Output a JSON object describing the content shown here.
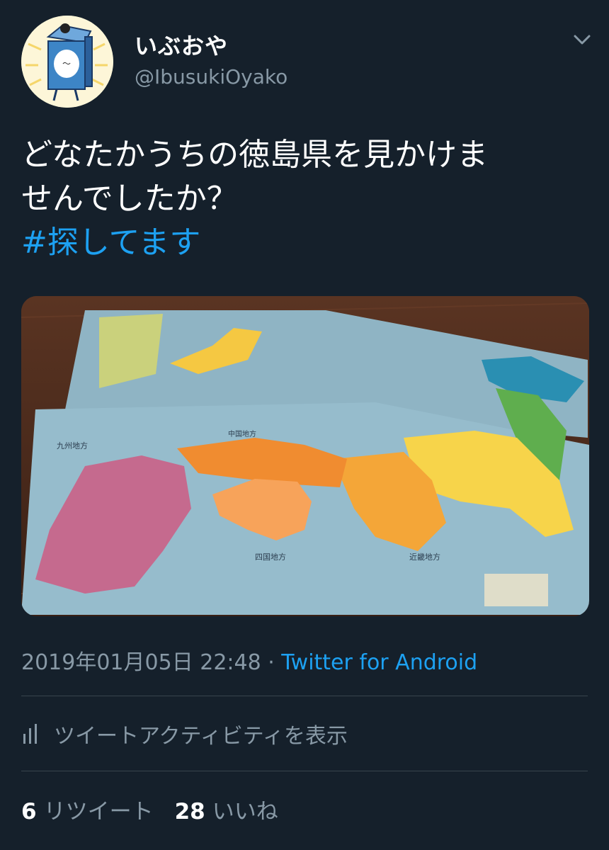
{
  "user": {
    "display_name": "いぶおや",
    "handle": "@IbusukiOyako"
  },
  "tweet": {
    "text_lines": [
      "どなたかうちの徳島県を見かけま",
      "せんでしたか？"
    ],
    "hashtag": "#探してます"
  },
  "media": {
    "labels": {
      "kyushu": "九州地方",
      "shikoku": "四国地方",
      "kinki": "近畿地方",
      "chugoku": "中国地方"
    }
  },
  "meta": {
    "timestamp": "2019年01月05日 22:48",
    "separator": " · ",
    "source": "Twitter for Android"
  },
  "activity": {
    "label": "ツイートアクティビティを表示"
  },
  "stats": {
    "retweets_count": "6",
    "retweets_label": "リツイート",
    "likes_count": "28",
    "likes_label": "いいね"
  },
  "colors": {
    "background": "#15202b",
    "link": "#1da1f2",
    "secondary_text": "#8899a6"
  }
}
